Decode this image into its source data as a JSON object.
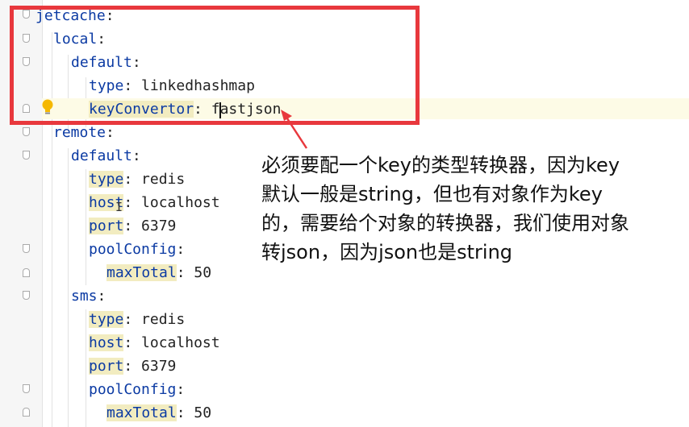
{
  "editor": {
    "lines": [
      {
        "key": "jetcache",
        "value": ""
      },
      {
        "key": "local",
        "value": ""
      },
      {
        "key": "default",
        "value": ""
      },
      {
        "key": "type",
        "value": "linkedhashmap"
      },
      {
        "key": "keyConvertor",
        "value": "fastjson"
      },
      {
        "key": "remote",
        "value": ""
      },
      {
        "key": "default",
        "value": ""
      },
      {
        "key": "type",
        "value": "redis"
      },
      {
        "key": "host",
        "value": "localhost"
      },
      {
        "key": "port",
        "value": "6379"
      },
      {
        "key": "poolConfig",
        "value": ""
      },
      {
        "key": "maxTotal",
        "value": "50"
      },
      {
        "key": "sms",
        "value": ""
      },
      {
        "key": "type",
        "value": "redis"
      },
      {
        "key": "host",
        "value": "localhost"
      },
      {
        "key": "port",
        "value": "6379"
      },
      {
        "key": "poolConfig",
        "value": ""
      },
      {
        "key": "maxTotal",
        "value": "50"
      }
    ]
  },
  "annotation": {
    "text": "必须要配一个key的类型转换器，因为key\n默认一般是string，但也有对象作为key\n的，需要给个对象的转换器，我们使用对象\n转json，因为json也是string",
    "box_color": "#e8383d",
    "arrow_color": "#e8383d"
  },
  "icons": {
    "intention": "lightbulb-icon"
  }
}
